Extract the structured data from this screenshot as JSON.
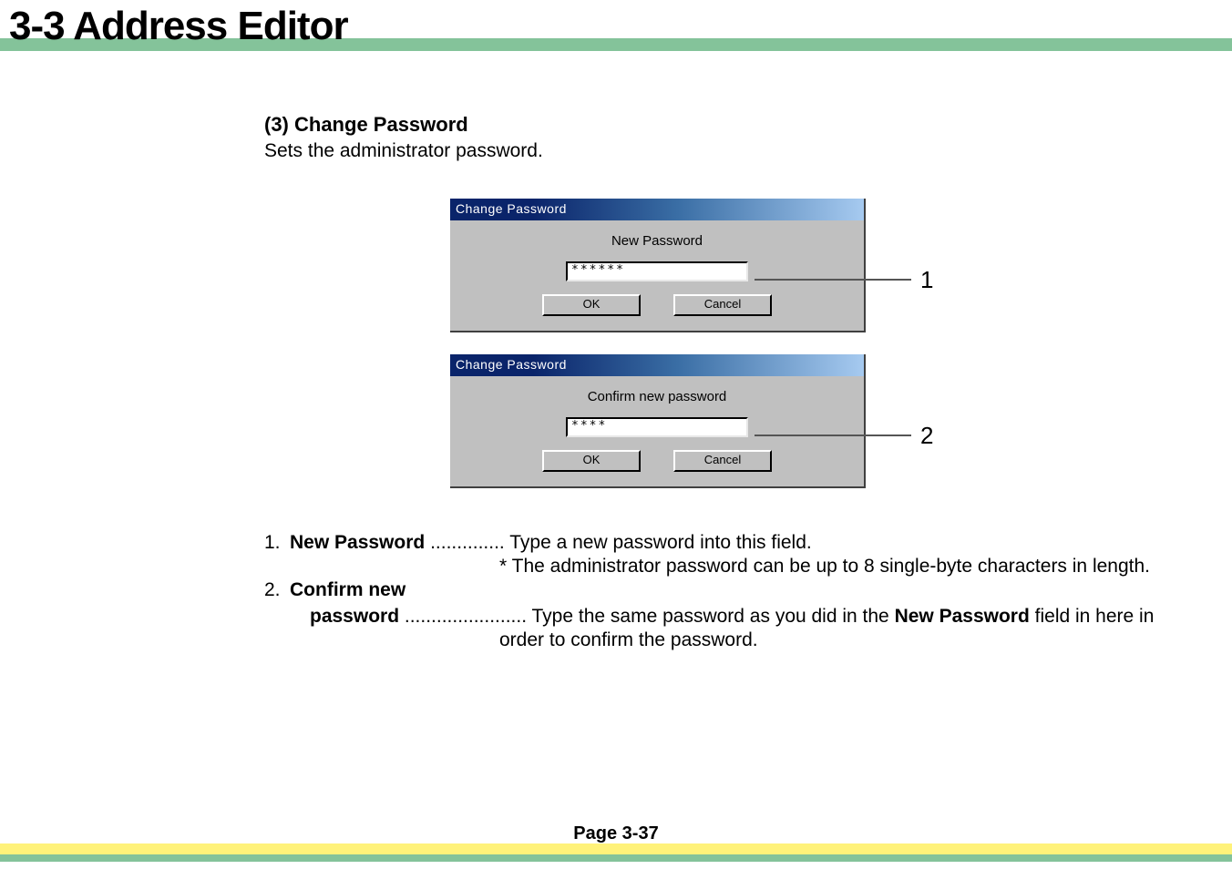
{
  "header": {
    "title": "3-3  Address Editor"
  },
  "section": {
    "heading": "(3) Change Password",
    "description": "Sets the administrator password."
  },
  "dialog1": {
    "title": "Change Password",
    "label": "New Password",
    "input_value": "******",
    "ok": "OK",
    "cancel": "Cancel",
    "callout": "1"
  },
  "dialog2": {
    "title": "Change Password",
    "label": "Confirm new password",
    "input_value": "****",
    "ok": "OK",
    "cancel": "Cancel",
    "callout": "2"
  },
  "list": {
    "item1_num": "1. ",
    "item1_label": "New Password",
    "item1_dots": " .............. ",
    "item1_text": "Type a new password into this field.",
    "item1_note": "* The administrator password can be up to 8 single-byte characters in length.",
    "item2_num": "2. ",
    "item2_label": "Confirm new",
    "item2_label2": "password",
    "item2_dots": " ....................... ",
    "item2_text_a": "Type the same password as you did in the ",
    "item2_bold": "New Password",
    "item2_text_b": " field in here in",
    "item2_cont": "order to confirm the password."
  },
  "footer": {
    "page": "Page 3-37"
  }
}
